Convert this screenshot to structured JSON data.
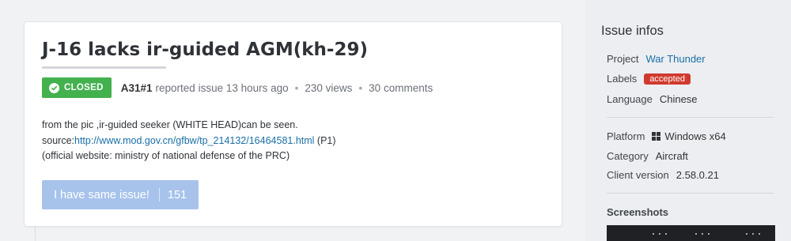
{
  "issue": {
    "title": "J-16 lacks ir-guided AGM(kh-29)",
    "status": "CLOSED",
    "author": "A31#1",
    "reported_text": "reported issue 13 hours ago",
    "views": "230 views",
    "comments": "30 comments",
    "body_line1": "from the pic ,ir-guided seeker (WHITE HEAD)can be seen.",
    "body_source_label": "source:",
    "body_link": "http://www.mod.gov.cn/gfbw/tp_214132/16464581.html",
    "body_link_suffix": " (P1)",
    "body_line3": "(official website: ministry of national defense of the PRC)",
    "same_issue_label": "I have same issue!",
    "same_issue_count": "151"
  },
  "sidebar": {
    "title": "Issue infos",
    "project_label": "Project",
    "project_value": "War Thunder",
    "labels_label": "Labels",
    "labels_value": "accepted",
    "language_label": "Language",
    "language_value": "Chinese",
    "platform_label": "Platform",
    "platform_value": "Windows x64",
    "platform_icon": "windows-icon",
    "category_label": "Category",
    "category_value": "Aircraft",
    "client_label": "Client version",
    "client_value": "2.58.0.21",
    "screenshots_label": "Screenshots"
  },
  "colors": {
    "closed_badge": "#44b14f",
    "accepted_badge": "#d03a2e",
    "link": "#1a6fa8",
    "same_issue_button": "#a7c3ec"
  }
}
